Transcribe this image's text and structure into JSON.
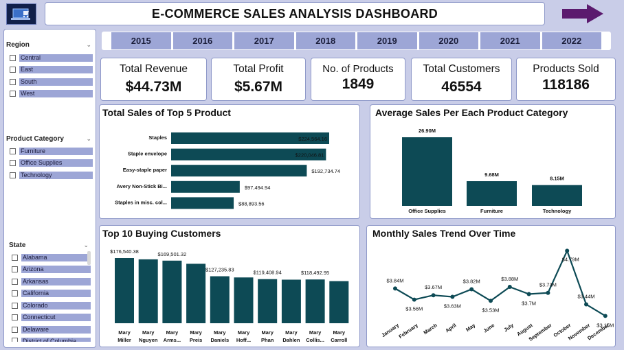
{
  "header": {
    "title": "E-COMMERCE SALES ANALYSIS DASHBOARD",
    "logo_icon": "laptop-cart-icon",
    "nav_icon": "arrow-right-icon"
  },
  "colors": {
    "bar": "#0d4a55",
    "slicer": "#9da6d6",
    "arrow": "#5b1a6e"
  },
  "region": {
    "label": "Region",
    "items": [
      "Central",
      "East",
      "South",
      "West"
    ]
  },
  "category": {
    "label": "Product Category",
    "items": [
      "Furniture",
      "Office Supplies",
      "Technology"
    ]
  },
  "state": {
    "label": "State",
    "items": [
      "Alabama",
      "Arizona",
      "Arkansas",
      "California",
      "Colorado",
      "Connecticut",
      "Delaware",
      "District of Columbia"
    ]
  },
  "years": [
    "2015",
    "2016",
    "2017",
    "2018",
    "2019",
    "2020",
    "2021",
    "2022"
  ],
  "kpis": [
    {
      "label": "Total Revenue",
      "value": "$44.73M"
    },
    {
      "label": "Total Profit",
      "value": "$5.67M"
    },
    {
      "label": "No. of Products",
      "value": "1849"
    },
    {
      "label": "Total Customers",
      "value": "46554"
    },
    {
      "label": "Products Sold",
      "value": "118186"
    }
  ],
  "chart_data": [
    {
      "type": "bar",
      "orientation": "horizontal",
      "title": "Total Sales of Top 5 Product",
      "categories": [
        "Staples",
        "Staple envelope",
        "Easy-staple paper",
        "Avery Non-Stick Bi...",
        "Staples in misc. col..."
      ],
      "values": [
        224564.16,
        220046.81,
        192734.74,
        97494.94,
        88893.56
      ],
      "labels": [
        "$224,564.16",
        "$220,046.81",
        "$192,734.74",
        "$97,494.94",
        "$88,893.56"
      ]
    },
    {
      "type": "bar",
      "title": "Average Sales Per Each Product Category",
      "categories": [
        "Office Supplies",
        "Furniture",
        "Technology"
      ],
      "values": [
        26.9,
        9.68,
        8.15
      ],
      "labels": [
        "26.90M",
        "9.68M",
        "8.15M"
      ]
    },
    {
      "type": "bar",
      "title": "Top 10 Buying Customers",
      "categories": [
        [
          "Mary",
          "Miller"
        ],
        [
          "Mary",
          "Nguyen"
        ],
        [
          "Mary",
          "Arms..."
        ],
        [
          "Mary",
          "Preis"
        ],
        [
          "Mary",
          "Daniels"
        ],
        [
          "Mary",
          "Hoff..."
        ],
        [
          "Mary",
          "Phan"
        ],
        [
          "Mary",
          "Dahlen"
        ],
        [
          "Mary",
          "Collis..."
        ],
        [
          "Mary",
          "Carroll"
        ]
      ],
      "values": [
        176540.38,
        173000,
        169501.32,
        161000,
        127235.83,
        124000,
        119408.94,
        118000,
        118492.95,
        114000
      ],
      "labels": [
        "$176,540.38",
        "",
        "$169,501.32",
        "",
        "$127,235.83",
        "",
        "$119,408.94",
        "",
        "$118,492.95",
        ""
      ]
    },
    {
      "type": "line",
      "title": "Monthly Sales Trend Over Time",
      "x": [
        "January",
        "February",
        "March",
        "April",
        "May",
        "June",
        "July",
        "August",
        "September",
        "October",
        "November",
        "December"
      ],
      "values": [
        3.84,
        3.56,
        3.67,
        3.63,
        3.82,
        3.53,
        3.88,
        3.7,
        3.73,
        4.79,
        3.44,
        3.15
      ],
      "labels": [
        "$3.84M",
        "$3.56M",
        "$3.67M",
        "$3.63M",
        "$3.82M",
        "$3.53M",
        "$3.88M",
        "$3.7M",
        "$3.73M",
        "$4.79M",
        "$3.44M",
        "$3.15M"
      ]
    }
  ]
}
